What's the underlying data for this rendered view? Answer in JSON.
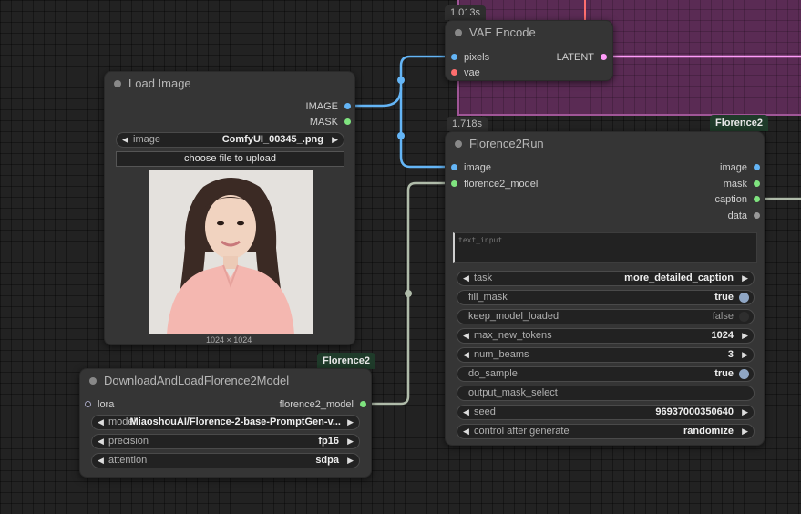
{
  "colors": {
    "image_link": "#64b5f6",
    "latent_link": "#ff9cf9",
    "model_link": "#b0bcaa",
    "vae_pin": "#ff6e6e",
    "green_pin": "#7fe37f",
    "group_bg": "#5a2b54"
  },
  "vae_encode": {
    "time": "1.013s",
    "title": "VAE Encode",
    "inputs": [
      "pixels",
      "vae"
    ],
    "output": "LATENT"
  },
  "load_image": {
    "title": "Load Image",
    "outputs": [
      "IMAGE",
      "MASK"
    ],
    "image_widget": {
      "label": "image",
      "value": "ComfyUI_00345_.png"
    },
    "upload_label": "choose file to upload",
    "image_size": "1024 × 1024"
  },
  "florence_run": {
    "time": "1.718s",
    "tag": "Florence2",
    "title": "Florence2Run",
    "inputs": [
      "image",
      "florence2_model"
    ],
    "outputs": [
      "image",
      "mask",
      "caption",
      "data"
    ],
    "text_placeholder": "text_input",
    "widgets": {
      "task": {
        "label": "task",
        "value": "more_detailed_caption"
      },
      "fill_mask": {
        "label": "fill_mask",
        "value": "true"
      },
      "keep_model_loaded": {
        "label": "keep_model_loaded",
        "value": "false"
      },
      "max_new_tokens": {
        "label": "max_new_tokens",
        "value": "1024"
      },
      "num_beams": {
        "label": "num_beams",
        "value": "3"
      },
      "do_sample": {
        "label": "do_sample",
        "value": "true"
      },
      "output_mask_select": {
        "label": "output_mask_select"
      },
      "seed": {
        "label": "seed",
        "value": "96937000350640"
      },
      "control_after_generate": {
        "label": "control after generate",
        "value": "randomize"
      }
    }
  },
  "download_model": {
    "tag": "Florence2",
    "title": "DownloadAndLoadFlorence2Model",
    "input": "lora",
    "output": "florence2_model",
    "widgets": {
      "model": {
        "label": "model",
        "value": "MiaoshouAI/Florence-2-base-PromptGen-v..."
      },
      "precision": {
        "label": "precision",
        "value": "fp16"
      },
      "attention": {
        "label": "attention",
        "value": "sdpa"
      }
    }
  }
}
